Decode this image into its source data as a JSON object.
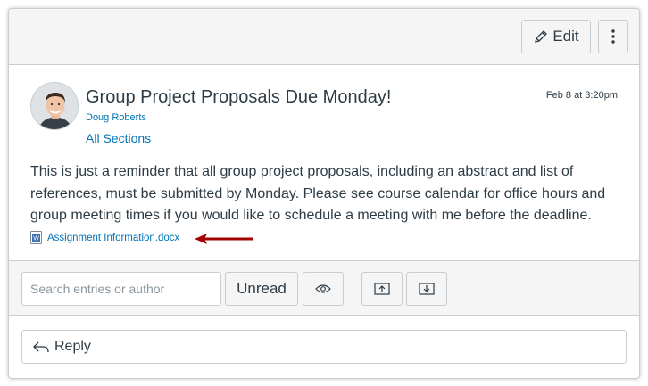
{
  "toolbar": {
    "edit_label": "Edit",
    "edit_icon": "pencil-icon",
    "more_icon": "kebab-vertical-icon"
  },
  "post": {
    "title": "Group Project Proposals Due Monday!",
    "author": "Doug Roberts",
    "sections": "All Sections",
    "date": "Feb 8 at 3:20pm",
    "body": "This is just a reminder that all group project proposals, including an abstract and list of references, must be submitted by Monday. Please see course calendar for office hours and group meeting times if you would like to schedule a meeting with me before the deadline.",
    "attachment": "Assignment Information.docx",
    "annotation_arrow_color": "#a30000"
  },
  "filters": {
    "search_placeholder": "Search entries or author",
    "unread_label": "Unread",
    "eye_icon": "eye-icon",
    "collapse_icon": "collapse-up-icon",
    "expand_icon": "expand-down-icon"
  },
  "reply": {
    "label": "Reply",
    "icon": "reply-arrow-icon"
  },
  "colors": {
    "link": "#0073b5",
    "text": "#2d3b45",
    "border": "#c7cdd1",
    "toolbar_bg": "#f5f5f5"
  }
}
